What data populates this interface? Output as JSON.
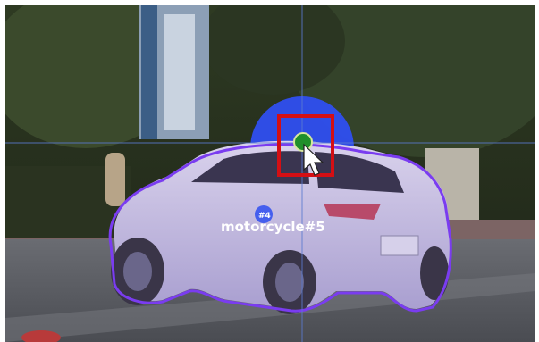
{
  "annotation": {
    "label": "motorcycle#5",
    "badge": "#4",
    "polygon_color": "#7a3cf0",
    "fill_color": "#6a5ad8",
    "handle_color": "#1f8f2a",
    "selection_box_color": "#d40f14",
    "circle_color": "#2f4ff0"
  },
  "crosshair": {
    "color": "#5a7ad0"
  },
  "cursor": {
    "icon": "arrow-pointer-icon"
  }
}
